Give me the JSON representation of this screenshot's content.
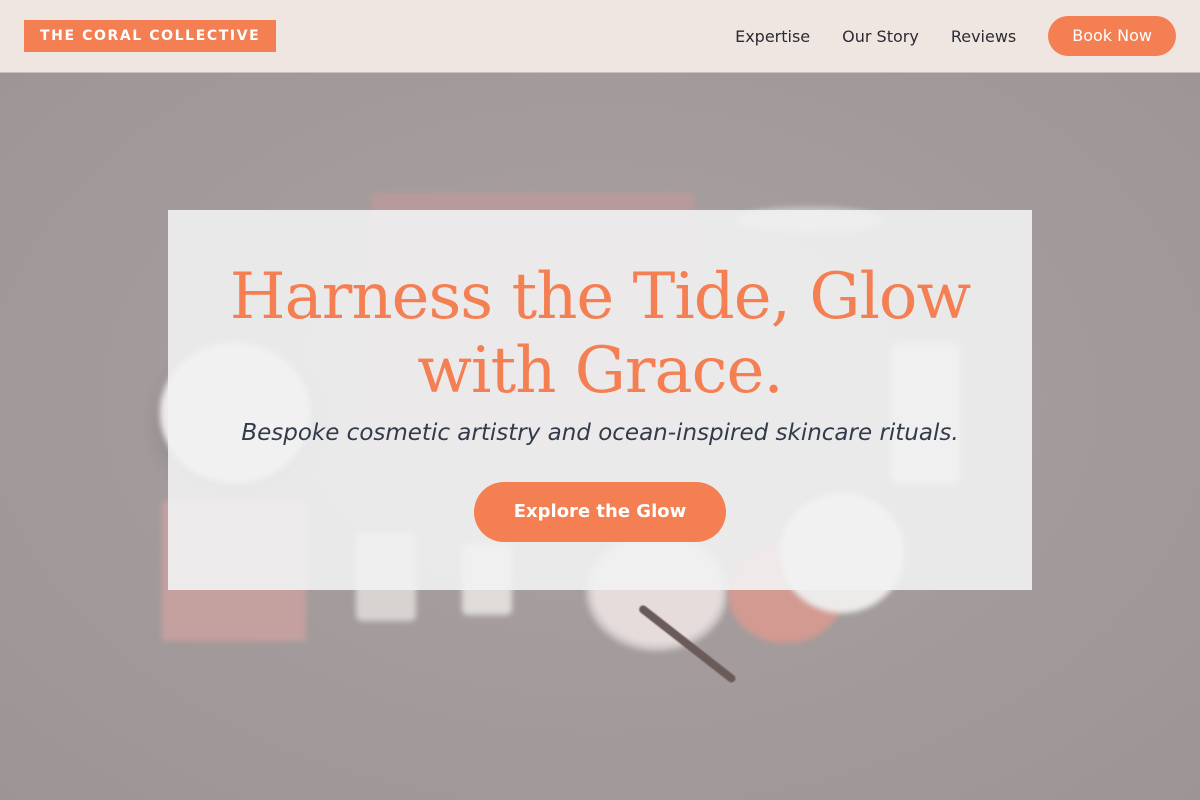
{
  "header": {
    "brand": "THE CORAL COLLECTIVE",
    "nav": [
      {
        "label": "Expertise"
      },
      {
        "label": "Our Story"
      },
      {
        "label": "Reviews"
      }
    ],
    "book_label": "Book Now"
  },
  "hero": {
    "title_line1": "Harness the Tide, Glow",
    "title_line2": "with Grace.",
    "subtitle": "Bespoke cosmetic artistry and ocean-inspired skincare rituals.",
    "cta_label": "Explore the Glow"
  },
  "colors": {
    "accent": "#f47f52",
    "header_bg": "#efe6e1",
    "hero_bg": "#a29a9a",
    "card_bg": "#f2f2f3",
    "text_dark": "#2b2b33"
  },
  "icons": {
    "hero_image": "cosmetics-flatlay-image"
  }
}
